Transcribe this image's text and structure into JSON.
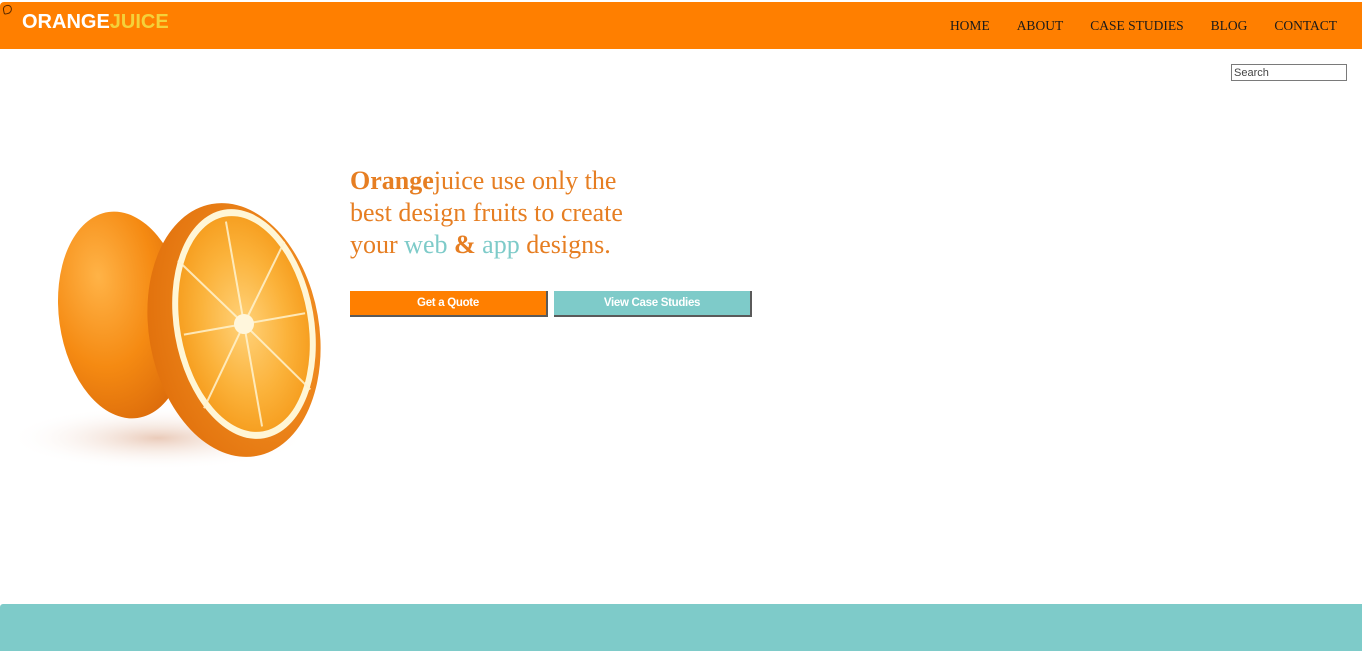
{
  "header": {
    "logo_part1": "ORANGE",
    "logo_part2": "JUICE",
    "nav": [
      "HOME",
      "ABOUT",
      "CASE STUDIES",
      "BLOG",
      "CONTACT"
    ]
  },
  "search": {
    "placeholder": "Search"
  },
  "hero": {
    "brand_bold": "Orange",
    "line1_rest": "juice use only the",
    "line2": "best design fruits to create",
    "line3_pre": "your ",
    "web": "web",
    "amp": "&",
    "app": "app",
    "line3_post": " designs."
  },
  "buttons": {
    "quote": "Get a Quote",
    "cases": "View Case Studies"
  },
  "colors": {
    "brand_orange": "#ff7f00",
    "accent_teal": "#7ecbc9",
    "logo_yellow": "#f4d13a",
    "hero_text": "#e67e22"
  },
  "images": {
    "hero_image": "orange-fruit-halved"
  }
}
